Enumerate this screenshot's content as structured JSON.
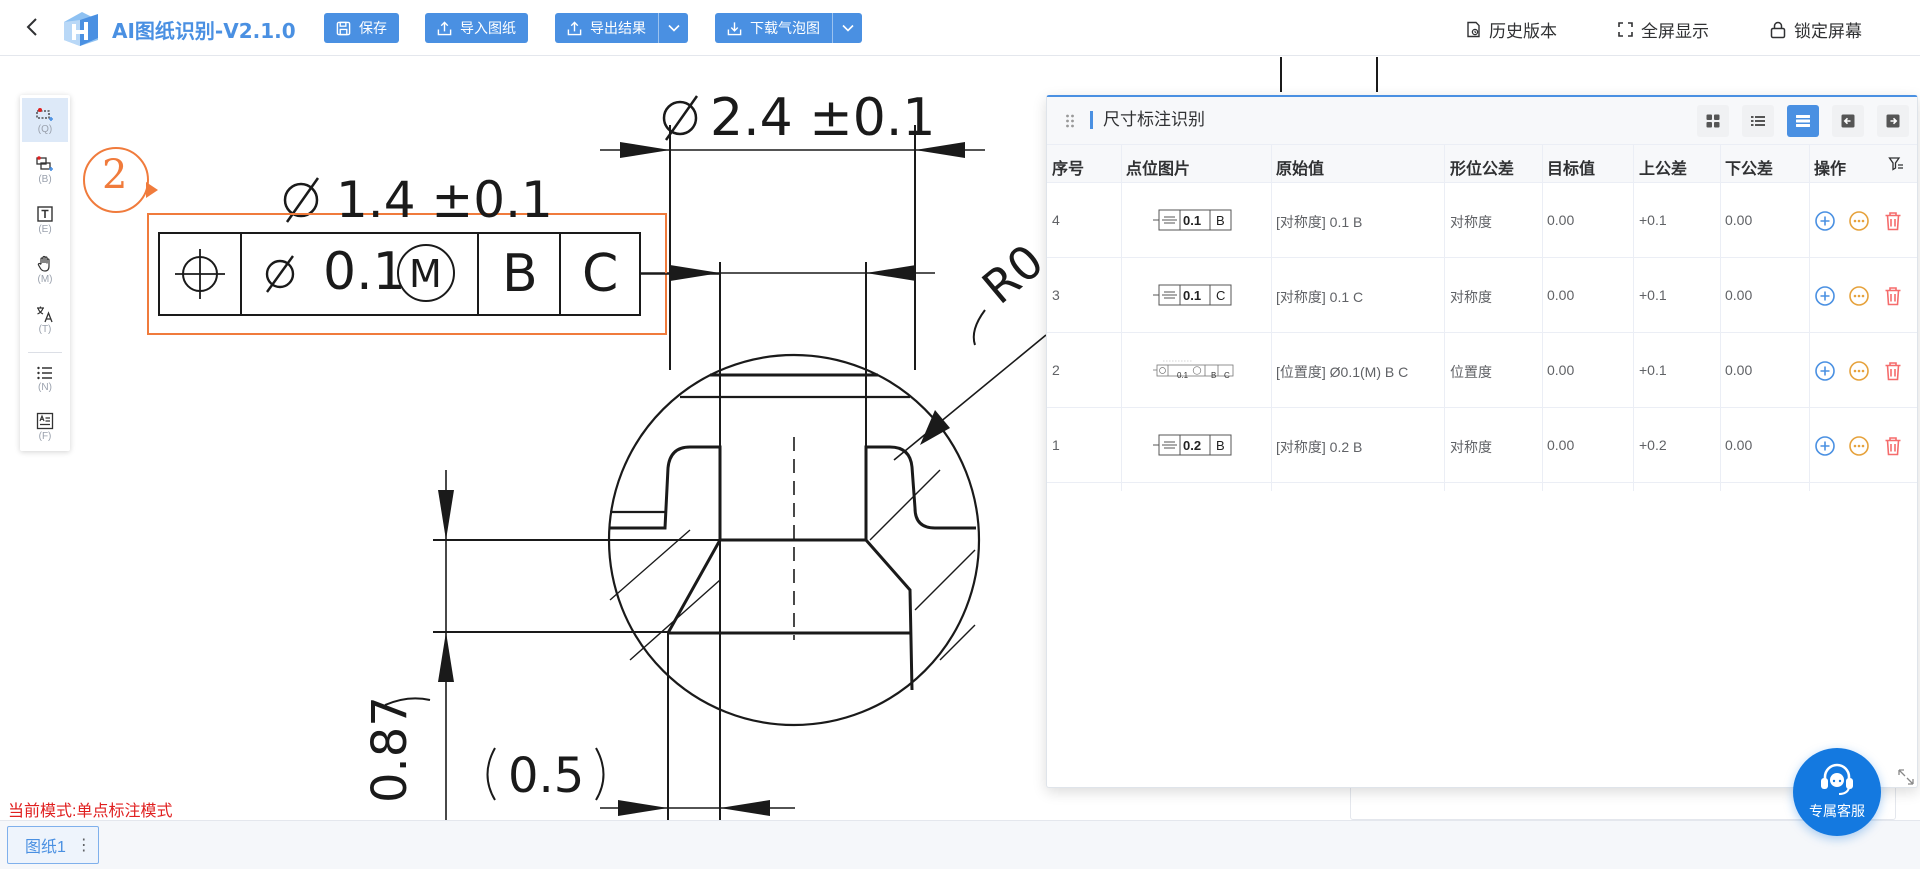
{
  "app": {
    "title": "AI图纸识别-V2.1.0"
  },
  "toolbar": {
    "save_label": "保存",
    "import_label": "导入图纸",
    "export_label": "导出结果",
    "download_label": "下载气泡图",
    "history_label": "历史版本",
    "fullscreen_label": "全屏显示",
    "lock_label": "锁定屏幕"
  },
  "left_tools": [
    {
      "name": "single-point",
      "key": "(Q)",
      "active": true
    },
    {
      "name": "batch",
      "key": "(B)"
    },
    {
      "name": "text",
      "key": "(E)"
    },
    {
      "name": "hand",
      "key": "(M)"
    },
    {
      "name": "translate",
      "key": "(T)"
    },
    {
      "name": "list",
      "key": "(N)"
    },
    {
      "name": "format",
      "key": "(F)"
    }
  ],
  "drawing": {
    "bubble_number": "2",
    "dim_top": "2.4 ±0.1",
    "dim_second": "1.4 ±0.1",
    "frame_value": "0.1",
    "frame_modifier": "M",
    "frame_datum1": "B",
    "frame_datum2": "C",
    "dim_bottom": "0.5",
    "dim_left": "0.87",
    "dim_radius": "R0"
  },
  "status": {
    "mode_text": "当前模式:单点标注模式"
  },
  "bottom": {
    "sheet_tab": "图纸1",
    "more_glyph": "⋮"
  },
  "panel": {
    "title": "尺寸标注识别",
    "columns": [
      "序号",
      "点位图片",
      "原始值",
      "形位公差",
      "目标值",
      "上公差",
      "下公差",
      "操作"
    ],
    "rows": [
      {
        "no": "4",
        "raw": "[对称度] 0.1 B",
        "type": "对称度",
        "target": "0.00",
        "upper": "+0.1",
        "lower": "0.00",
        "thumb_value": "0.1",
        "thumb_datum": "B"
      },
      {
        "no": "3",
        "raw": "[对称度] 0.1 C",
        "type": "对称度",
        "target": "0.00",
        "upper": "+0.1",
        "lower": "0.00",
        "thumb_value": "0.1",
        "thumb_datum": "C"
      },
      {
        "no": "2",
        "raw": "[位置度] Ø0.1(M) B C",
        "type": "位置度",
        "target": "0.00",
        "upper": "+0.1",
        "lower": "0.00",
        "thumb_value": "0.1",
        "thumb_datum": "B",
        "thumb_datum2": "C"
      },
      {
        "no": "1",
        "raw": "[对称度] 0.2 B",
        "type": "对称度",
        "target": "0.00",
        "upper": "+0.2",
        "lower": "0.00",
        "thumb_value": "0.2",
        "thumb_datum": "B"
      }
    ]
  },
  "support": {
    "label": "专属客服"
  },
  "colors": {
    "primary": "#4a90e2",
    "bubble": "#f07b3c",
    "mode_text": "#e02020",
    "support": "#1479e0",
    "delete": "#f56c6c",
    "more": "#e6a23c"
  }
}
